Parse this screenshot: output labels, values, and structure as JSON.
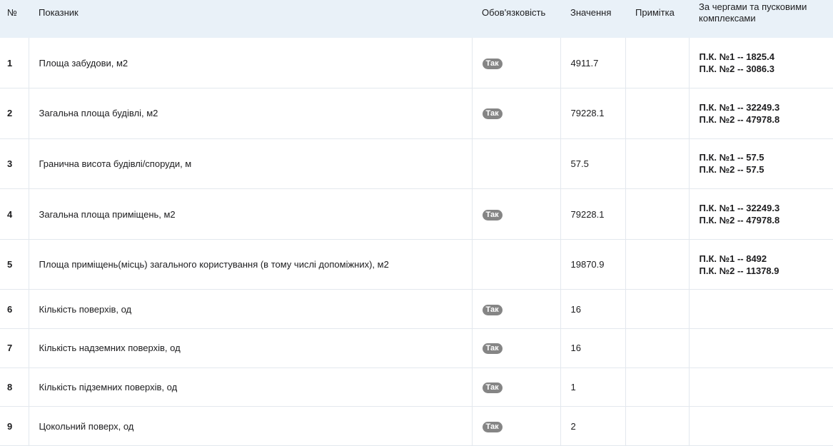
{
  "headers": {
    "num": "№",
    "indicator": "Показник",
    "required": "Обов'язковість",
    "value": "Значення",
    "note": "Примітка",
    "phases": "За чергами та пусковими комплексами"
  },
  "rows": [
    {
      "num": "1",
      "indicator": "Площа забудови, м2",
      "required": "Так",
      "value": "4911.7",
      "note": "",
      "phases": [
        "П.К. №1 -- 1825.4",
        "П.К. №2 -- 3086.3"
      ]
    },
    {
      "num": "2",
      "indicator": "Загальна площа будівлі, м2",
      "required": "Так",
      "value": "79228.1",
      "note": "",
      "phases": [
        "П.К. №1 -- 32249.3",
        "П.К. №2 -- 47978.8"
      ]
    },
    {
      "num": "3",
      "indicator": "Гранична висота будівлі/споруди, м",
      "required": "",
      "value": "57.5",
      "note": "",
      "phases": [
        "П.К. №1 -- 57.5",
        "П.К. №2 -- 57.5"
      ]
    },
    {
      "num": "4",
      "indicator": "Загальна площа приміщень, м2",
      "required": "Так",
      "value": "79228.1",
      "note": "",
      "phases": [
        "П.К. №1 -- 32249.3",
        "П.К. №2 -- 47978.8"
      ]
    },
    {
      "num": "5",
      "indicator": "Площа приміщень(місць) загального користування (в тому числі допоміжних), м2",
      "required": "",
      "value": "19870.9",
      "note": "",
      "phases": [
        "П.К. №1 -- 8492",
        "П.К. №2 -- 11378.9"
      ]
    },
    {
      "num": "6",
      "indicator": "Кількість поверхів, од",
      "required": "Так",
      "value": "16",
      "note": "",
      "phases": []
    },
    {
      "num": "7",
      "indicator": "Кількість надземних поверхів, од",
      "required": "Так",
      "value": "16",
      "note": "",
      "phases": []
    },
    {
      "num": "8",
      "indicator": "Кількість підземних поверхів, од",
      "required": "Так",
      "value": "1",
      "note": "",
      "phases": []
    },
    {
      "num": "9",
      "indicator": "Цокольний поверх, од",
      "required": "Так",
      "value": "2",
      "note": "",
      "phases": []
    }
  ],
  "colors": {
    "header_bg": "#e9f1f8",
    "badge_bg": "#858585",
    "border": "#e3e8ee"
  }
}
